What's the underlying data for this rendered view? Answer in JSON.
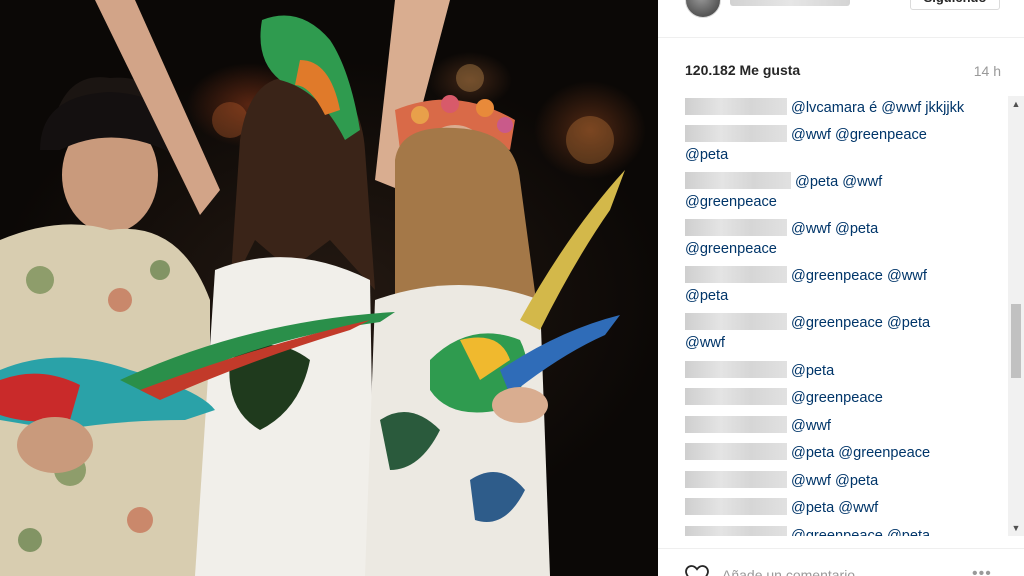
{
  "post": {
    "follow_label": "Siguiendo",
    "likes": "120.182 Me gusta",
    "time": "14 h",
    "comments": [
      {
        "lines": [
          "@lvcamara é @wwf jkkjjkk"
        ]
      },
      {
        "lines": [
          "@wwf @greenpeace",
          "@peta"
        ]
      },
      {
        "lines": [
          "@peta @wwf",
          "@greenpeace"
        ]
      },
      {
        "lines": [
          "@wwf @peta",
          "@greenpeace"
        ]
      },
      {
        "lines": [
          "@greenpeace @wwf",
          "@peta"
        ]
      },
      {
        "lines": [
          "@greenpeace @peta",
          "@wwf"
        ]
      },
      {
        "lines": [
          "@peta"
        ]
      },
      {
        "lines": [
          "@greenpeace"
        ]
      },
      {
        "lines": [
          "@wwf"
        ]
      },
      {
        "lines": [
          "@peta @greenpeace"
        ]
      },
      {
        "lines": [
          "@wwf @peta"
        ]
      },
      {
        "lines": [
          "@peta @wwf"
        ]
      },
      {
        "lines": [
          "@greenpeace @peta"
        ]
      }
    ],
    "add_comment_placeholder": "Añade un comentario...",
    "more_options": "•••"
  },
  "icons": {
    "heart": "heart-icon",
    "more": "more-options-icon",
    "scroll_up": "scroll-up-icon",
    "scroll_down": "scroll-down-icon"
  },
  "colors": {
    "mention": "#003569",
    "text": "#262626",
    "muted": "#999999"
  }
}
